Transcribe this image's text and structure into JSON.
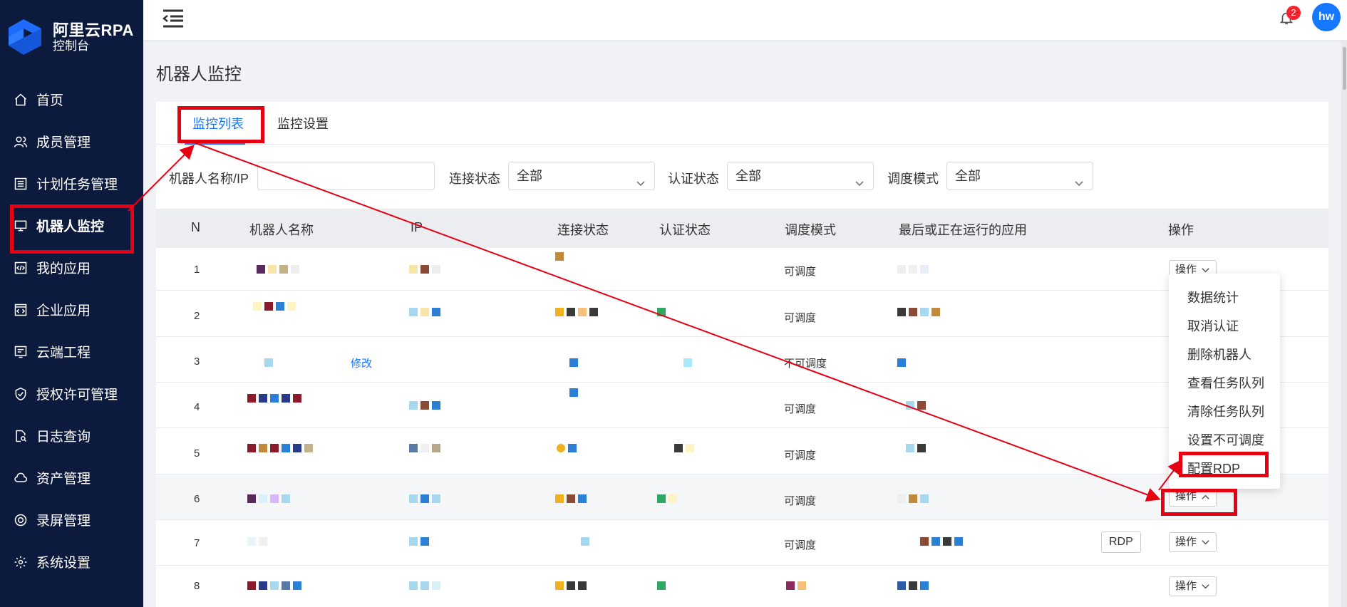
{
  "brand": {
    "title": "阿里云RPA",
    "subtitle": "控制台"
  },
  "sidebar": {
    "items": [
      {
        "label": "首页",
        "icon": "home-icon"
      },
      {
        "label": "成员管理",
        "icon": "users-icon"
      },
      {
        "label": "计划任务管理",
        "icon": "list-icon"
      },
      {
        "label": "机器人监控",
        "icon": "monitor-icon",
        "active": true
      },
      {
        "label": "我的应用",
        "icon": "code-file-icon"
      },
      {
        "label": "企业应用",
        "icon": "code-window-icon"
      },
      {
        "label": "云端工程",
        "icon": "cloud-project-icon"
      },
      {
        "label": "授权许可管理",
        "icon": "shield-icon"
      },
      {
        "label": "日志查询",
        "icon": "log-search-icon"
      },
      {
        "label": "资产管理",
        "icon": "cloud-icon"
      },
      {
        "label": "录屏管理",
        "icon": "record-icon"
      },
      {
        "label": "系统设置",
        "icon": "gear-icon"
      }
    ]
  },
  "header": {
    "notification_count": "2",
    "avatar": "hw"
  },
  "page": {
    "title": "机器人监控"
  },
  "tabs": [
    {
      "label": "监控列表",
      "active": true
    },
    {
      "label": "监控设置"
    }
  ],
  "filters": {
    "name_ip_label": "机器人名称/IP",
    "name_ip_value": "",
    "connection_label": "连接状态",
    "connection_value": "全部",
    "auth_label": "认证状态",
    "auth_value": "全部",
    "schedule_label": "调度模式",
    "schedule_value": "全部"
  },
  "table": {
    "headers": [
      "N",
      "机器人名称",
      "IP",
      "连接状态",
      "认证状态",
      "调度模式",
      "最后或正在运行的应用",
      "操作"
    ],
    "rows": [
      {
        "n": "1",
        "schedule": "可调度",
        "op": "操作"
      },
      {
        "n": "2",
        "schedule": "可调度"
      },
      {
        "n": "3",
        "schedule": "不可调度",
        "edit": "修改"
      },
      {
        "n": "4",
        "schedule": "可调度"
      },
      {
        "n": "5",
        "schedule": "可调度"
      },
      {
        "n": "6",
        "schedule": "可调度",
        "op": "操作"
      },
      {
        "n": "7",
        "schedule": "可调度",
        "op": "操作",
        "rdp": "RDP"
      },
      {
        "n": "8",
        "op": "操作"
      }
    ]
  },
  "dropdown": {
    "items": [
      "数据统计",
      "取消认证",
      "删除机器人",
      "查看任务队列",
      "清除任务队列",
      "设置不可调度",
      "配置RDP"
    ]
  },
  "colors": {
    "sidebar_bg": "#0c1a3d",
    "accent": "#1677ff",
    "annotation": "#e60012"
  }
}
